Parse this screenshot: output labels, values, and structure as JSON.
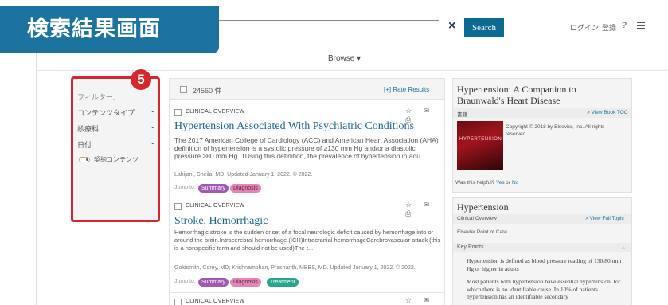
{
  "badge": {
    "title": "検索結果画面",
    "number": "5"
  },
  "header": {
    "search_value": "",
    "search_button": "Search",
    "clear_icon": "×",
    "login": "ログイン",
    "register": "登録",
    "help_icon": "?"
  },
  "browse": {
    "label": "Browse ▾"
  },
  "sidebar": {
    "filter_label": "フィルター:",
    "items": [
      "コンテンツタイプ",
      "診療科",
      "日付"
    ],
    "toggle_label": "契約コンテンツ"
  },
  "results": {
    "count": "24560 件",
    "rate_link": "[+] Rate Results",
    "items": [
      {
        "type": "CLINICAL OVERVIEW",
        "title": "Hypertension Associated With Psychiatric Conditions",
        "snippet": "The 2017 American College of Cardiology (ACC) and American Heart Association (AHA) definition of hypertension is a systolic pressure of ≥130 mm Hg and/or a diastolic pressure ≥80 mm Hg. 1Using this definition, the prevalence of hypertension in adu...",
        "meta": "Lahijani, Sheila, MD. Updated January 1, 2022. © 2022.",
        "jump": "Jump to:",
        "tags": [
          "Summary",
          "Diagnosis"
        ]
      },
      {
        "type": "CLINICAL OVERVIEW",
        "title": "Stroke, Hemorrhagic",
        "snippet": "Hemorrhagic stroke is the sudden onset of a focal neurologic deficit caused by hemorrhage into or around the brain.Intracerebral hemorrhage (ICH)Intracranial hemorrhageCerebrovascular attack (this is a nonspecific term and should not be used)The t...",
        "meta": "Goldsmith, Corey, MD; Krishnamohan, Prashanth, MBBS, MD. Updated January 1, 2022. © 2022.",
        "jump": "Jump to:",
        "tags": [
          "Summary",
          "Diagnosis",
          "Treatment"
        ]
      },
      {
        "type": "CLINICAL OVERVIEW"
      }
    ],
    "row_icons": "☆ ✉ ⎙"
  },
  "right_panel_book": {
    "title_line1": "Hypertension: A Companion to",
    "title_line2": "Braunwald's Heart Disease",
    "label": "書籍",
    "view_link": "> View Book TOC",
    "copyright": "Copyright © 2018 by Elsevier, Inc. All rights reserved.",
    "cover_text": "HYPERTENSION",
    "helpful": "Was this helpful?",
    "yes": "Yes",
    "or": "or",
    "no": "No"
  },
  "right_panel_topic": {
    "title": "Hypertension",
    "subtitle": "Clinical Overview",
    "view_link": "> View Full Topic",
    "source": "Elsevier Point of Care",
    "key_points": "Key Points",
    "point1": "Hypertension is defined as blood pressure reading of 130/80 mm Hg or higher in adults",
    "point2": "Most patients with hypertension have essential hypertension, for which there is no identifiable cause. In 10% of patients , hypertension has an identifiable secondary"
  },
  "colors": {
    "badge_blue": "#1c73a0",
    "highlight_red": "#d6262e",
    "link_blue": "#1a6794",
    "tag_summary": "#a15ab2",
    "tag_diagnosis": "#e584b6",
    "tag_treatment": "#27a78a"
  }
}
